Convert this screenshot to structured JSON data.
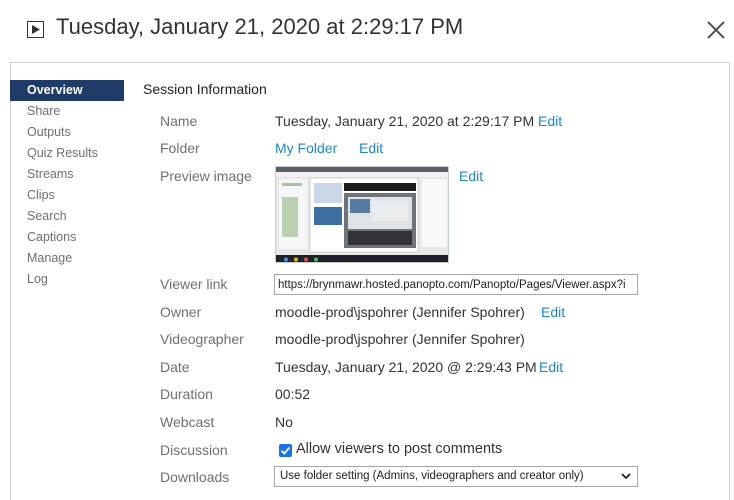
{
  "header": {
    "title": "Tuesday, January 21, 2020 at 2:29:17 PM",
    "title_icon": "play-square-icon",
    "close_icon": "close-icon"
  },
  "nav": {
    "items": [
      {
        "label": "Overview",
        "active": true
      },
      {
        "label": "Share"
      },
      {
        "label": "Outputs"
      },
      {
        "label": "Quiz Results"
      },
      {
        "label": "Streams"
      },
      {
        "label": "Clips"
      },
      {
        "label": "Search"
      },
      {
        "label": "Captions"
      },
      {
        "label": "Manage"
      },
      {
        "label": "Log"
      }
    ]
  },
  "section": {
    "title": "Session Information"
  },
  "fields": {
    "name": {
      "label": "Name",
      "value": "Tuesday, January 21, 2020 at 2:29:17 PM",
      "edit": "Edit"
    },
    "folder": {
      "label": "Folder",
      "value": "My Folder",
      "edit": "Edit"
    },
    "preview": {
      "label": "Preview image",
      "edit": "Edit"
    },
    "viewer_link": {
      "label": "Viewer link",
      "value": "https://brynmawr.hosted.panopto.com/Panopto/Pages/Viewer.aspx?i"
    },
    "owner": {
      "label": "Owner",
      "value": "moodle-prod\\jspohrer (Jennifer Spohrer)",
      "edit": "Edit"
    },
    "videographer": {
      "label": "Videographer",
      "value": "moodle-prod\\jspohrer (Jennifer Spohrer)"
    },
    "date": {
      "label": "Date",
      "value": "Tuesday, January 21, 2020 @ 2:29:43 PM",
      "edit": "Edit"
    },
    "duration": {
      "label": "Duration",
      "value": "00:52"
    },
    "webcast": {
      "label": "Webcast",
      "value": "No"
    },
    "discussion": {
      "label": "Discussion",
      "checkbox_label": "Allow viewers to post comments",
      "checked": true
    },
    "downloads": {
      "label": "Downloads",
      "selected": "Use folder setting (Admins, videographers and creator only)"
    }
  },
  "colors": {
    "nav_active": "#1f3b68",
    "link": "#1e88c7",
    "checkbox": "#1a73e8"
  }
}
